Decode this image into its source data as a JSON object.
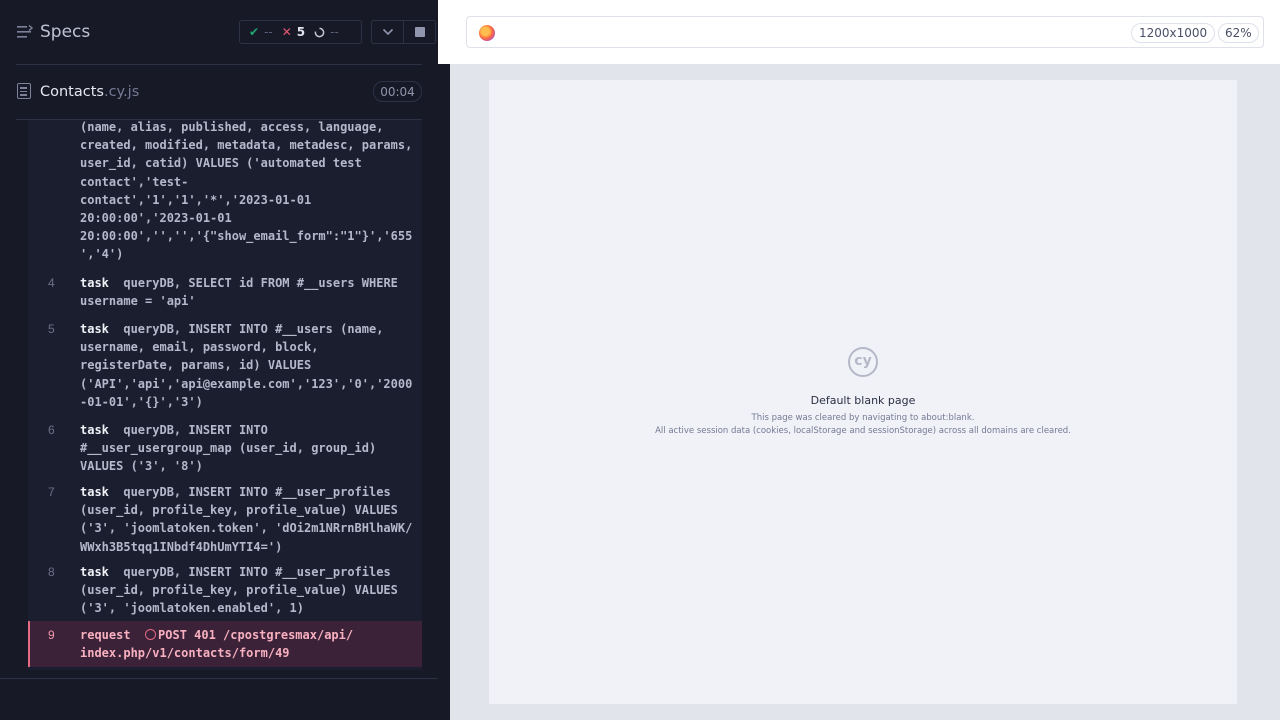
{
  "sidebar": {
    "title": "Specs",
    "stats": {
      "passed": "--",
      "failed": "5",
      "pending": "--"
    },
    "colors": {
      "pass": "#1fa971",
      "fail": "#e45770",
      "pending": "#9095ad"
    }
  },
  "spec": {
    "name": "Contacts",
    "ext": ".cy.js",
    "duration": "00:04"
  },
  "commands": [
    {
      "num": "",
      "keyword": "",
      "message": "(name, alias, published, access, language,\ncreated, modified, metadata, metadesc, params,\nuser_id, catid) VALUES ('automated test\ncontact','test-\ncontact','1','1','*','2023-01-01\n20:00:00','2023-01-01\n20:00:00','','','{\"show_email_form\":\"1\"}','655\n','4')"
    },
    {
      "num": "4",
      "keyword": "task",
      "message": "queryDB, SELECT id FROM #__users WHERE\nusername = 'api'"
    },
    {
      "num": "5",
      "keyword": "task",
      "message": "queryDB, INSERT INTO #__users (name,\nusername, email, password, block,\nregisterDate, params, id) VALUES\n('API','api','api@example.com','123','0','2000\n-01-01','{}','3')"
    },
    {
      "num": "6",
      "keyword": "task",
      "message": "queryDB, INSERT INTO\n#__user_usergroup_map (user_id, group_id)\nVALUES ('3', '8')"
    },
    {
      "num": "7",
      "keyword": "task",
      "message": "queryDB, INSERT INTO #__user_profiles\n(user_id, profile_key, profile_value) VALUES\n('3', 'joomlatoken.token', 'dOi2m1NRrnBHlhaWK/\nWWxh3B5tqq1INbdf4DhUmYTI4=')"
    },
    {
      "num": "8",
      "keyword": "task",
      "message": "queryDB, INSERT INTO #__user_profiles\n(user_id, profile_key, profile_value) VALUES\n('3', 'joomlatoken.enabled', 1)"
    },
    {
      "num": "9",
      "keyword": "request",
      "message": "POST 401 /cpostgresmax/api/\nindex.php/v1/contacts/form/49"
    }
  ],
  "browser": {
    "viewport": "1200x1000",
    "zoom": "62%"
  },
  "blank_page": {
    "title": "Default blank page",
    "line1": "This page was cleared by navigating to about:blank.",
    "line2": "All active session data (cookies, localStorage and sessionStorage) across all domains are cleared."
  }
}
